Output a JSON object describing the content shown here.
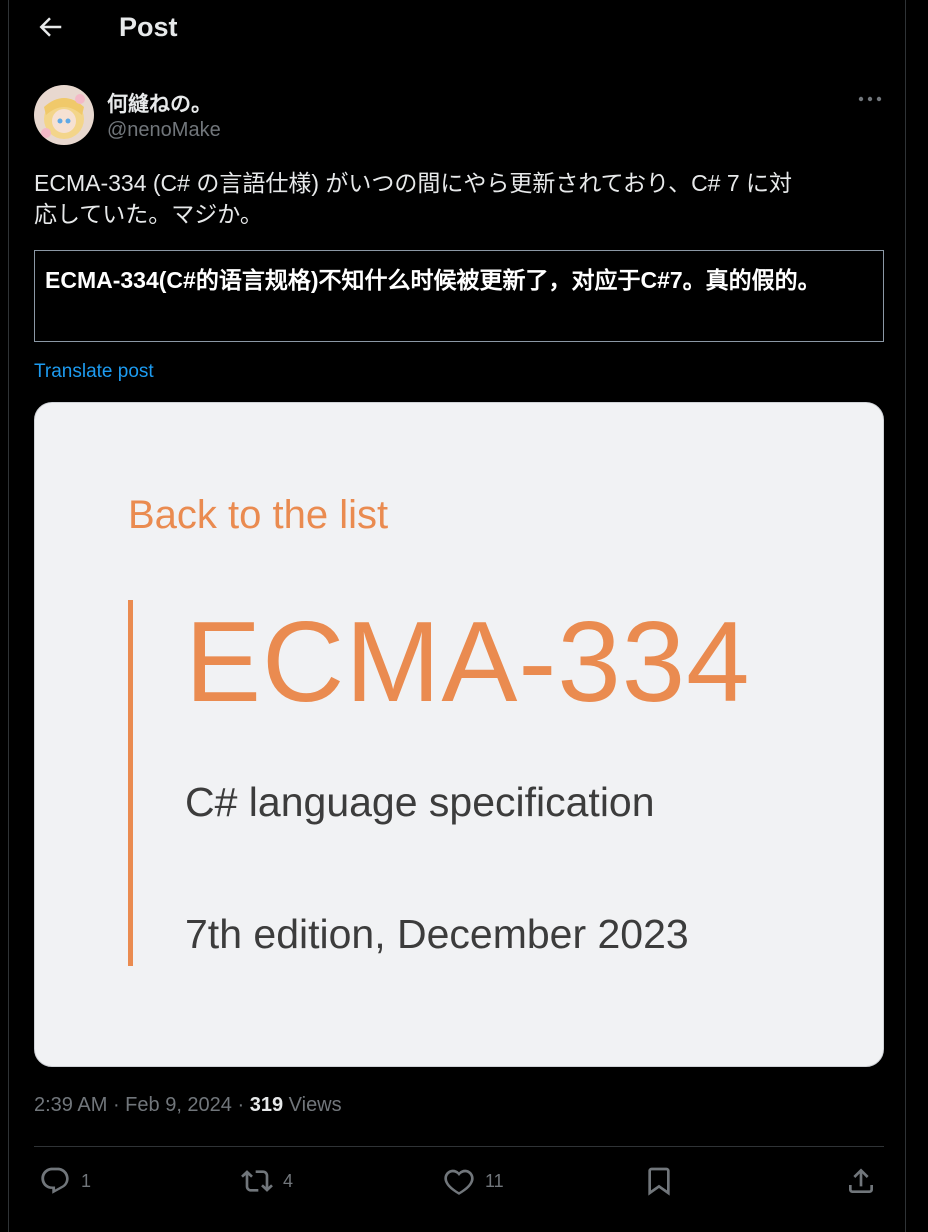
{
  "header": {
    "title": "Post"
  },
  "author": {
    "display_name": "何縫ねの。",
    "handle": "@nenoMake"
  },
  "post": {
    "text_line1": "ECMA-334 (C# の言語仕様) がいつの間にやら更新されており、C# 7 に対",
    "text_line2": "応していた。マジか。"
  },
  "translation": {
    "text": "ECMA-334(C#的语言规格)不知什么时候被更新了，对应于C#7。真的假的。",
    "link_label": "Translate post"
  },
  "media": {
    "back_label": "Back to the list",
    "title": "ECMA-334",
    "subtitle": "C# language specification",
    "edition": "7th edition, December 2023",
    "accent_color": "#ea8b50"
  },
  "meta": {
    "time": "2:39 AM",
    "date": "Feb 9, 2024",
    "views_count": "319",
    "views_label": "Views"
  },
  "actions": {
    "replies": "1",
    "reposts": "4",
    "likes": "11"
  },
  "colors": {
    "background": "#000000",
    "link": "#1d9bf0",
    "muted": "#71767b"
  }
}
